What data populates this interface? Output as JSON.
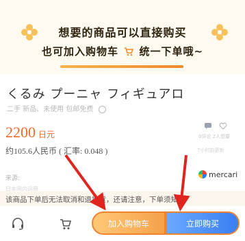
{
  "banner": {
    "headline_line1": "想要的商品可以直接购买",
    "headline_line2_prefix": "也可加入购物车",
    "headline_line2_suffix": "统一下单哦~",
    "flower_icon": "flower-icon",
    "cart_emoji_icon": "shopping-cart-icon"
  },
  "product": {
    "title": "くるみ プーニャ フィギュアロ",
    "tags": "二手  新品、未使用  包邮免费",
    "price_value": "2200",
    "price_unit": "日元",
    "rmb_text": "约105.6人民币 ( 汇率: 0.048 )",
    "comments": "0评论 2人想要",
    "updated": "7小时前更新",
    "source_label": "来源:",
    "source_name": "mercari",
    "faded_line": "日本国内运费",
    "notice": "该商品下单后无法取消和退换货，还请注意，下单须知。"
  },
  "bottom_bar": {
    "add_to_cart": "加入购物车",
    "buy_now": "立即购买",
    "support_icon": "headset-icon",
    "cart_icon": "cart-icon"
  },
  "colors": {
    "accent_orange": "#f06a2a",
    "add_button": "#f5a14a",
    "buy_button": "#3a7ef2",
    "annotation_red": "#e0251f"
  }
}
